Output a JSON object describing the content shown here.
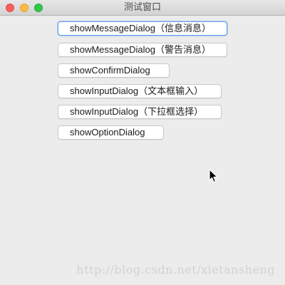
{
  "window": {
    "title": "测试窗口"
  },
  "buttons": [
    {
      "label": "showMessageDialog（信息消息）",
      "focused": true
    },
    {
      "label": "showMessageDialog（警告消息）",
      "focused": false
    },
    {
      "label": "showConfirmDialog",
      "focused": false
    },
    {
      "label": "showInputDialog（文本框输入）",
      "focused": false
    },
    {
      "label": "showInputDialog（下拉框选择）",
      "focused": false
    },
    {
      "label": "showOptionDialog",
      "focused": false
    }
  ],
  "watermark": {
    "text": "http://blog.csdn.net/xietansheng"
  },
  "colors": {
    "close": "#fc605c",
    "minimize": "#fdbc40",
    "maximize": "#34c84a",
    "focus_ring": "#6aa2e6"
  }
}
